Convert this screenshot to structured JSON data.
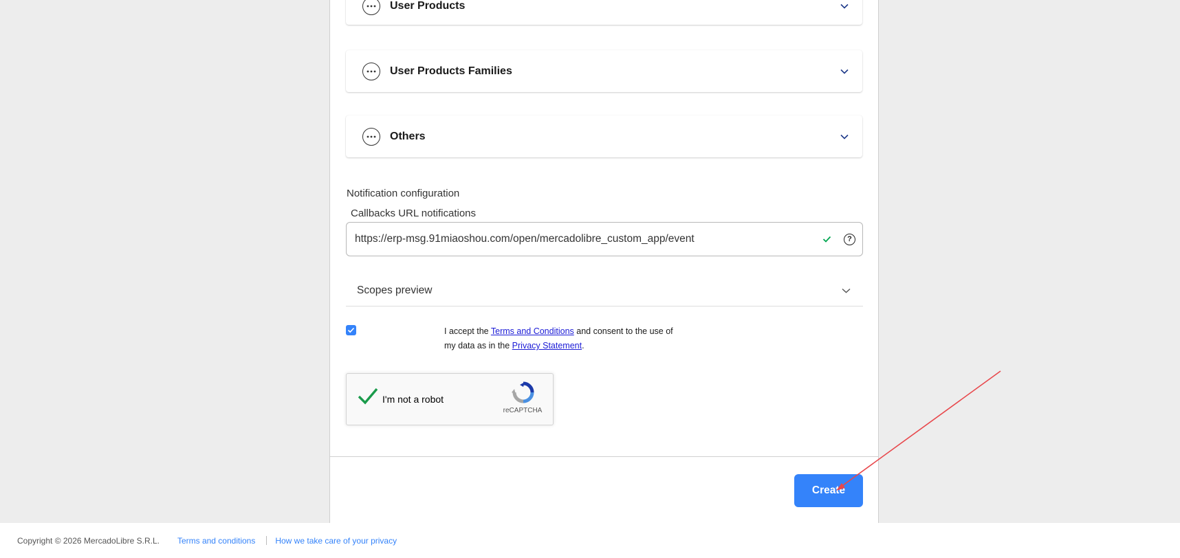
{
  "accordions": [
    {
      "title": "User Products",
      "icon": "more-horizontal-icon"
    },
    {
      "title": "User Products Families",
      "icon": "more-horizontal-icon"
    },
    {
      "title": "Others",
      "icon": "more-horizontal-icon"
    }
  ],
  "notification": {
    "section_title": "Notification configuration",
    "callbacks_label": "Callbacks URL notifications",
    "callbacks_url": "https://erp-msg.91miaoshou.com/open/mercadolibre_custom_app/event"
  },
  "scopes": {
    "label": "Scopes preview"
  },
  "consent": {
    "checked": true,
    "text_1": "I accept the ",
    "terms_link": "Terms and Conditions",
    "text_2": " and consent to the use of my data as in the ",
    "privacy_link": "Privacy Statement",
    "text_3": "."
  },
  "recaptcha": {
    "label": "I'm not a robot",
    "brand": "reCAPTCHA",
    "verified": true
  },
  "create_button": {
    "label": "Create"
  },
  "footer": {
    "copyright": "Copyright © 2026 MercadoLibre S.R.L.",
    "links": [
      "Terms and conditions",
      "How we take care of your privacy"
    ]
  },
  "colors": {
    "primary": "#3483fa",
    "success": "#00a650",
    "annotation_arrow": "#e8474b",
    "background": "#ededed"
  }
}
